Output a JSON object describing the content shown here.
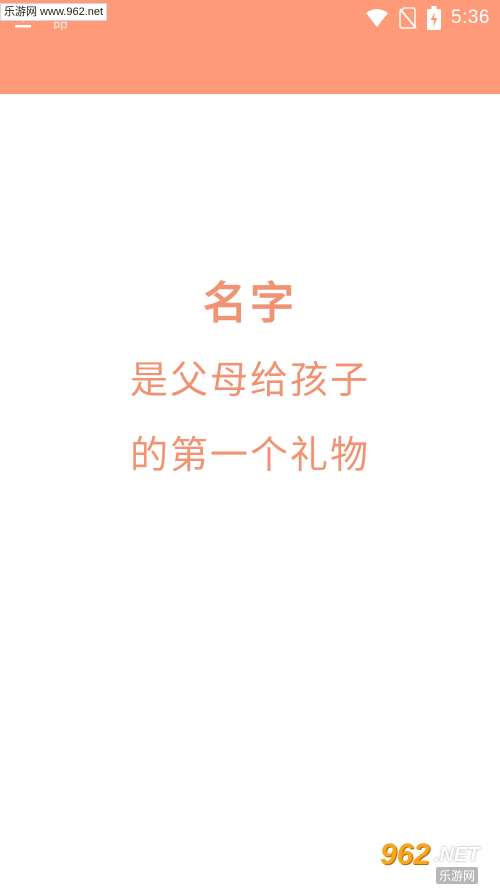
{
  "watermark": {
    "top_text": "乐游网 www.962.net",
    "bottom_number": "962",
    "bottom_net": ".NET",
    "bottom_cn": "乐游网"
  },
  "app_bar": {
    "title_fragment": "命",
    "background_color": "#ff9a79"
  },
  "status_bar": {
    "time": "5:36",
    "icons": [
      "wifi-icon",
      "no-sim-icon",
      "battery-charging-icon"
    ]
  },
  "main": {
    "title": "名字",
    "line2": "是父母给孩子",
    "line3": "的第一个礼物",
    "text_color": "#f19372"
  }
}
